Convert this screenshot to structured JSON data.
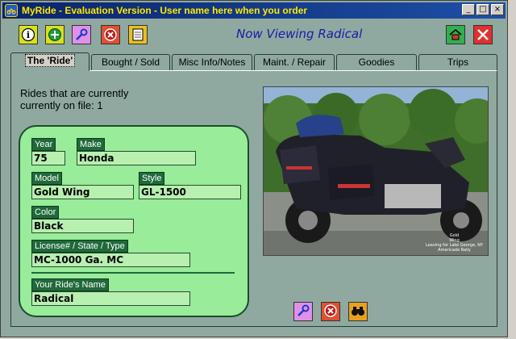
{
  "window": {
    "title": "MyRide - Evaluation Version - User name here when you order",
    "icon": "motorcycle-app-icon",
    "controls": [
      "minimize",
      "maximize",
      "close"
    ]
  },
  "toolbar": {
    "left_buttons": [
      "info-icon",
      "add-icon",
      "wrench-icon",
      "delete-icon",
      "notepad-icon"
    ],
    "right_buttons": [
      "home-icon",
      "close-icon"
    ],
    "heading": "Now Viewing Radical"
  },
  "tabs": [
    {
      "label": "The 'Ride'",
      "active": true
    },
    {
      "label": "Bought / Sold",
      "active": false
    },
    {
      "label": "Misc Info/Notes",
      "active": false
    },
    {
      "label": "Maint. / Repair",
      "active": false
    },
    {
      "label": "Goodies",
      "active": false
    },
    {
      "label": "Trips",
      "active": false
    }
  ],
  "rides_info": "Rides that are currently currently on file: 1",
  "fields": {
    "year": {
      "label": "Year",
      "value": "75"
    },
    "make": {
      "label": "Make",
      "value": "Honda"
    },
    "model": {
      "label": "Model",
      "value": "Gold Wing"
    },
    "style": {
      "label": "Style",
      "value": "GL-1500"
    },
    "color": {
      "label": "Color",
      "value": "Black"
    },
    "license": {
      "label": "License# / State / Type",
      "value": "MC-1000 Ga. MC"
    },
    "ride_name": {
      "label": "Your Ride's Name",
      "value": "Radical"
    }
  },
  "photo": {
    "caption": [
      "Gold",
      "Wing",
      "Leaving for Lake George, NY",
      "Americade Rally"
    ]
  },
  "bottom_buttons": [
    "wrench-icon",
    "delete-icon",
    "binoculars-icon"
  ],
  "colors": {
    "window_bg": "#8fa9a0",
    "title_bar": "#0a246a",
    "title_text": "#ffea00",
    "card_bg": "#99ec99",
    "field_label_bg": "#1f6a3a",
    "heading": "#1a1aa8"
  }
}
